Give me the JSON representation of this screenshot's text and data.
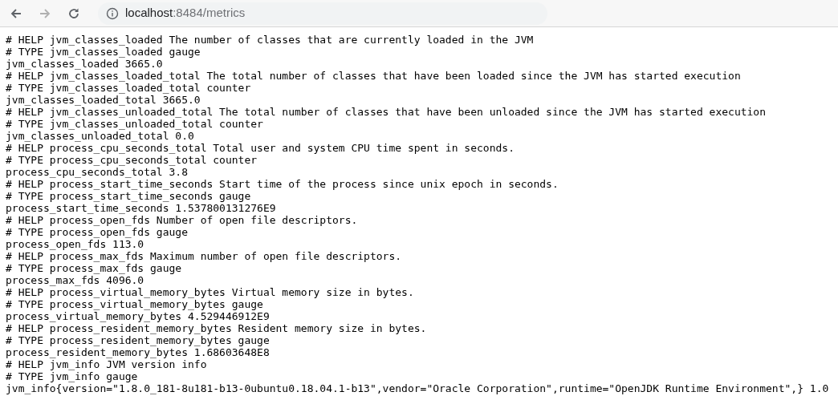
{
  "toolbar": {
    "nav_buttons": [
      {
        "kind": "back",
        "disabled": false
      },
      {
        "kind": "forward",
        "disabled": true
      },
      {
        "kind": "reload",
        "disabled": false
      }
    ],
    "address": {
      "host": "localhost",
      "path": ":8484/metrics"
    }
  },
  "page_lines": [
    "# HELP jvm_classes_loaded The number of classes that are currently loaded in the JVM",
    "# TYPE jvm_classes_loaded gauge",
    "jvm_classes_loaded 3665.0",
    "# HELP jvm_classes_loaded_total The total number of classes that have been loaded since the JVM has started execution",
    "# TYPE jvm_classes_loaded_total counter",
    "jvm_classes_loaded_total 3665.0",
    "# HELP jvm_classes_unloaded_total The total number of classes that have been unloaded since the JVM has started execution",
    "# TYPE jvm_classes_unloaded_total counter",
    "jvm_classes_unloaded_total 0.0",
    "# HELP process_cpu_seconds_total Total user and system CPU time spent in seconds.",
    "# TYPE process_cpu_seconds_total counter",
    "process_cpu_seconds_total 3.8",
    "# HELP process_start_time_seconds Start time of the process since unix epoch in seconds.",
    "# TYPE process_start_time_seconds gauge",
    "process_start_time_seconds 1.537800131276E9",
    "# HELP process_open_fds Number of open file descriptors.",
    "# TYPE process_open_fds gauge",
    "process_open_fds 113.0",
    "# HELP process_max_fds Maximum number of open file descriptors.",
    "# TYPE process_max_fds gauge",
    "process_max_fds 4096.0",
    "# HELP process_virtual_memory_bytes Virtual memory size in bytes.",
    "# TYPE process_virtual_memory_bytes gauge",
    "process_virtual_memory_bytes 4.529446912E9",
    "# HELP process_resident_memory_bytes Resident memory size in bytes.",
    "# TYPE process_resident_memory_bytes gauge",
    "process_resident_memory_bytes 1.68603648E8",
    "# HELP jvm_info JVM version info",
    "# TYPE jvm_info gauge",
    "jvm_info{version=\"1.8.0_181-8u181-b13-0ubuntu0.18.04.1-b13\",vendor=\"Oracle Corporation\",runtime=\"OpenJDK Runtime Environment\",} 1.0"
  ]
}
